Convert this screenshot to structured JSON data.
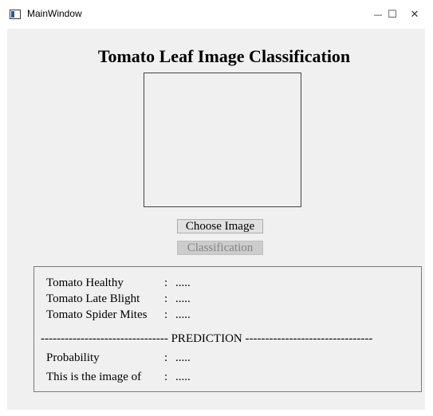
{
  "window": {
    "title": "MainWindow",
    "minimize_glyph": "—",
    "maximize_glyph": "☐",
    "close_glyph": "✕"
  },
  "main": {
    "heading": "Tomato Leaf Image Classification",
    "choose_button": "Choose Image",
    "classify_button": "Classification"
  },
  "results": {
    "rows": [
      {
        "label": "Tomato Healthy",
        "colon": ":",
        "value": "....."
      },
      {
        "label": "Tomato Late Blight",
        "colon": ":",
        "value": "....."
      },
      {
        "label": "Tomato Spider Mites",
        "colon": ":",
        "value": "....."
      }
    ],
    "divider": "-------------------------------- PREDICTION --------------------------------",
    "probability": {
      "label": "Probability",
      "colon": ":",
      "value": "....."
    },
    "image_of": {
      "label": "This is the image of",
      "colon": ":",
      "value": "....."
    }
  }
}
